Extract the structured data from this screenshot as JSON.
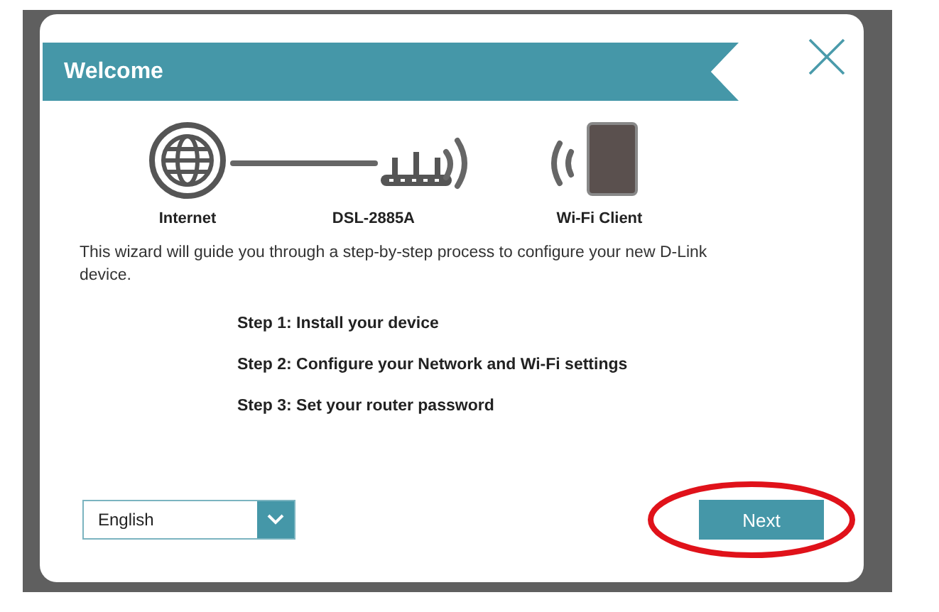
{
  "dialog": {
    "title": "Welcome",
    "diagram": [
      {
        "kind": "globe",
        "label": "Internet"
      },
      {
        "kind": "router",
        "label": "DSL-2885A"
      },
      {
        "kind": "client",
        "label": "Wi-Fi Client"
      }
    ],
    "intro": "This wizard will guide you through a step-by-step process to configure your new D-Link device.",
    "steps": [
      "Step 1: Install your device",
      "Step 2: Configure your Network and Wi-Fi settings",
      "Step 3: Set your router password"
    ],
    "language": {
      "value": "English"
    },
    "next_button": {
      "label": "Next",
      "highlighted": true
    }
  }
}
